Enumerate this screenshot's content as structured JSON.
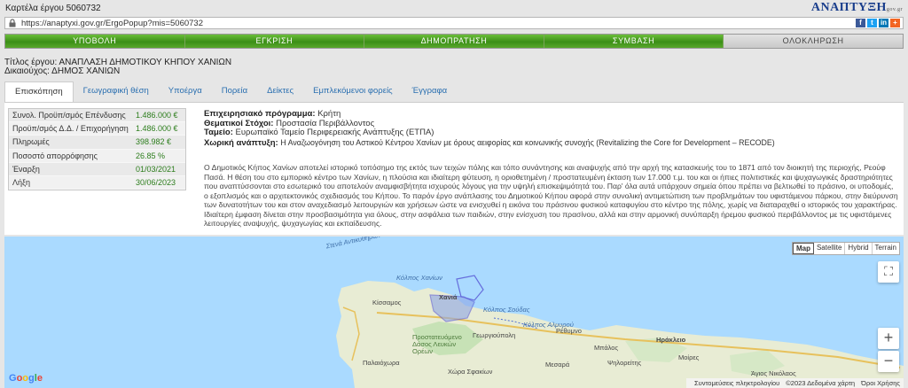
{
  "window": {
    "title": "Καρτέλα έργου 5060732",
    "brand": "ΑΝΑΠΤΥΞΗ",
    "brand_suffix": "gov.gr"
  },
  "urlbar": {
    "url": "https://anaptyxi.gov.gr/ErgoPopup?mis=5060732"
  },
  "stages": [
    {
      "label": "ΥΠΟΒΟΛΗ",
      "done": true
    },
    {
      "label": "ΕΓΚΡΙΣΗ",
      "done": true
    },
    {
      "label": "ΔΗΜΟΠΡΑΤΗΣΗ",
      "done": true
    },
    {
      "label": "ΣΥΜΒΑΣΗ",
      "done": true
    },
    {
      "label": "ΟΛΟΚΛΗΡΩΣΗ",
      "done": false
    }
  ],
  "project": {
    "title": "Τίτλος έργου: ΑΝΑΠΛΑΣΗ ΔΗΜΟΤΙΚΟΥ ΚΗΠΟΥ ΧΑΝΙΩΝ",
    "beneficiary": "Δικαιούχος: ΔΗΜΟΣ ΧΑΝΙΩΝ"
  },
  "tabs": [
    "Επισκόπηση",
    "Γεωγραφική θέση",
    "Υποέργα",
    "Πορεία",
    "Δείκτες",
    "Εμπλεκόμενοι φορείς",
    "Έγγραφα"
  ],
  "finance": [
    {
      "label": "Συνολ. Προϋπ/σμός Επένδυσης",
      "value": "1.486.000 €"
    },
    {
      "label": "Προϋπ/σμός Δ.Δ. / Επιχορήγηση",
      "value": "1.486.000 €"
    },
    {
      "label": "Πληρωμές",
      "value": "398.982 €"
    },
    {
      "label": "Ποσοστό απορρόφησης",
      "value": "26.85 %"
    },
    {
      "label": "Έναρξη",
      "value": "01/03/2021"
    },
    {
      "label": "Λήξη",
      "value": "30/06/2023"
    }
  ],
  "info": [
    {
      "label": "Επιχειρησιακό πρόγραμμα:",
      "value": "Κρήτη"
    },
    {
      "label": "Θεματικοί Στόχοι:",
      "value": "Προστασία Περιβάλλοντος"
    },
    {
      "label": "Ταμείο:",
      "value": "Ευρωπαϊκό Ταμείο Περιφερειακής Ανάπτυξης (ΕΤΠΑ)"
    },
    {
      "label": "Χωρική ανάπτυξη:",
      "value": "Η Αναζωογόνηση του Αστικού Κέντρου Χανίων με όρους αειφορίας και κοινωνικής συνοχής (Revitalizing the Core for Development – RECODE)"
    }
  ],
  "description": "Ο Δημοτικός Κήπος Χανίων αποτελεί ιστορικό τοπόσημο της εκτός των τειχών πόλης και τόπο συνάντησης και αναψυχής από την αρχή της κατασκευής του το 1871 από τον διοικητή της περιοχής, Ρεούφ Πασά. Η θέση του στο εμπορικό κέντρο των Χανίων, η πλούσια και ιδιαίτερη φύτευση, η οριοθετημένη / προστατευμένη έκταση των 17.000 τ.μ. του και οι ήπιες πολιτιστικές και ψυχαγωγικές δραστηριότητες που αναπτύσσονται στο εσωτερικό του αποτελούν αναμφισβήτητα ισχυρούς λόγους για την υψηλή επισκεψιμότητά του. Παρ' όλα αυτά υπάρχουν σημεία όπου πρέπει να βελτιωθεί το πράσινο, οι υποδομές, ο εξοπλισμός και ο αρχιτεκτονικός σχεδιασμός του Κήπου. Το παρόν έργο ανάπλασης του Δημοτικού Κήπου αφορά στην συνολική αντιμετώπιση των προβλημάτων του υφιστάμενου πάρκου, στην διεύρυνση των δυνατοτήτων του και στον αναχεδιασμό λειτουργιών και χρήσεων ώστε να ενισχυθεί η εικόνα του πράσινου φυσικού καταφυγίου στο κέντρο της πόλης, χωρίς να διαταραχθεί ο ιστορικός του χαρακτήρας. Ιδιαίτερη έμφαση δίνεται στην προσβασιμότητα για όλους, στην ασφάλεια των παιδιών, στην ενίσχυση του πρασίνου, αλλά και στην αρμονική συνύπαρξη ήρεμου φυσικού περιβάλλοντος με τις υφιστάμενες λειτουργίες αναψυχής, ψυχαγωγίας και εκπαίδευσης.",
  "map": {
    "types": [
      "Map",
      "Satellite",
      "Hybrid",
      "Terrain"
    ],
    "selected_type": "Map",
    "labels": {
      "strait": "Στενά Αντικυθήρων",
      "gulf_chania": "Κόλπος Χανίων",
      "city": "Χανιά",
      "kissamos": "Κίσσαμος",
      "souda": "Κόλπος Σούδας",
      "almyros": "Κόλπος Αλμυρού",
      "georgioupoli": "Γεωργιούπολη",
      "rethymno": "Ρέθυμνο",
      "heraklion": "Ηράκλειο",
      "protected": "Προστατευόμενο Δάσος Λευκών Ορέων",
      "paleochora": "Παλαιόχωρα",
      "sfakia": "Χώρα Σφακίων",
      "moires": "Μοίρες",
      "agios_nikolaos": "Άγιος Νικόλαος",
      "cape": "Μπάλος",
      "rethymno_hills": "Ψηλορείτης",
      "messara": "Μεσαρά"
    },
    "google": "Google",
    "attribution": [
      "Συντομεύσεις πληκτρολογίου",
      "©2023 Δεδομένα χάρτη",
      "Όροι Χρήσης"
    ]
  },
  "icons": {
    "lock": "lock-icon",
    "facebook": "facebook-icon",
    "twitter": "twitter-icon",
    "linkedin": "linkedin-icon",
    "plus_share": "share-plus-icon",
    "fullscreen": "fullscreen-icon",
    "zoom_in": "zoom-in-icon",
    "zoom_out": "zoom-out-icon"
  },
  "colors": {
    "stage_done": "#4aa21f",
    "stage_pending": "#d6d6d6",
    "value_green": "#2c7d1c",
    "link_blue": "#2a6fb0",
    "boundary": "#5a5ad6"
  }
}
